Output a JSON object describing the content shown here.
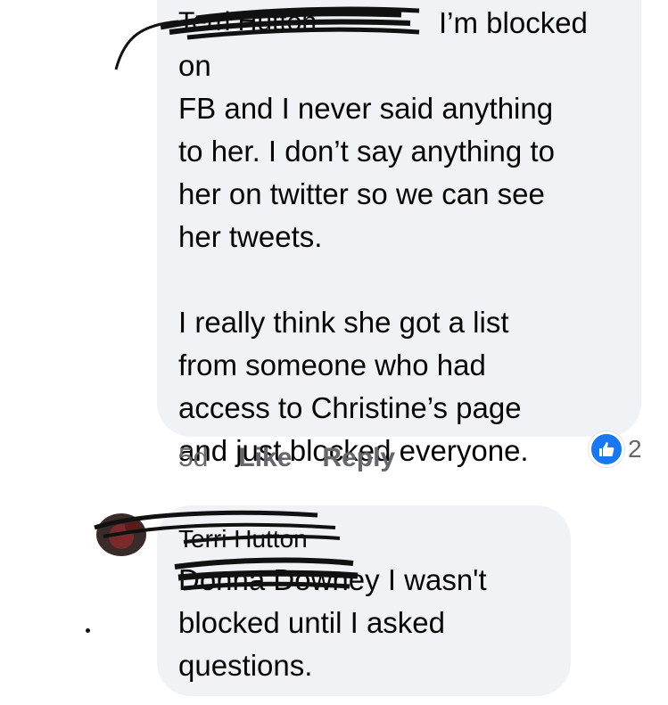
{
  "comment1": {
    "author": "Terri Hutton",
    "text": "I’m blocked on\nFB and I never said anything\nto her. I don’t say anything to\nher on twitter so we can see\nher tweets.\n\nI really think she got a list\nfrom someone who had\naccess to Christine’s page\nand just blocked everyone.",
    "time": "5d",
    "like_label": "Like",
    "reply_label": "Reply",
    "reaction_count": "2",
    "reaction_icon": "thumbs-up-icon",
    "reaction_color": "#1877f2"
  },
  "comment2": {
    "author": "Terri Hutton",
    "mention": "Donna Downey",
    "text": "I wasn't\nblocked until I asked\nquestions."
  },
  "colors": {
    "bubble": "#f0f2f5",
    "meta_text": "#65676b",
    "like_blue": "#1877f2"
  }
}
